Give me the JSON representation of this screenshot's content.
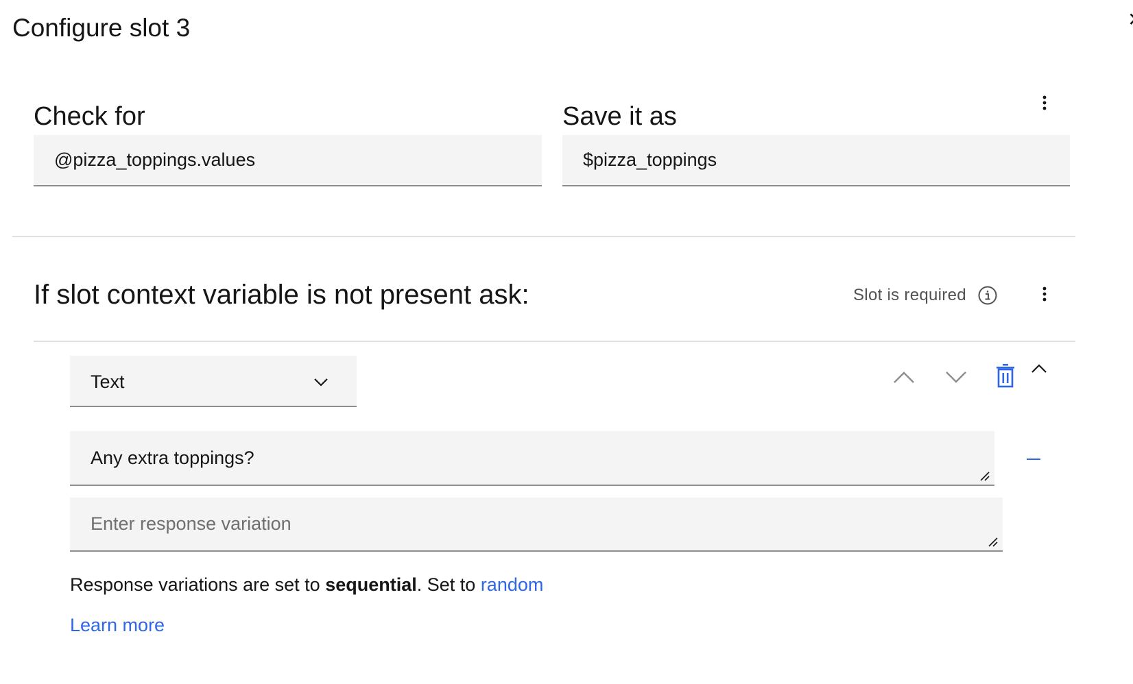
{
  "header": {
    "title": "Configure slot 3"
  },
  "check_for": {
    "label": "Check for",
    "value": "@pizza_toppings.values"
  },
  "save_as": {
    "label": "Save it as",
    "value": "$pizza_toppings"
  },
  "prompt_section": {
    "title": "If slot context variable is not present ask:",
    "required_label": "Slot is required"
  },
  "response": {
    "type_selected": "Text",
    "variation_1": "Any extra toppings?",
    "variation_placeholder": "Enter response variation"
  },
  "variation_info": {
    "prefix": "Response variations are set to ",
    "mode": "sequential",
    "middle": ". Set to ",
    "link": "random"
  },
  "learn_more": "Learn more",
  "colors": {
    "link": "#2f66e8",
    "delete_icon": "#2f66e8",
    "field_bg": "#f4f4f4",
    "field_border": "#8d8d8d",
    "divider": "#e0e0e0"
  }
}
